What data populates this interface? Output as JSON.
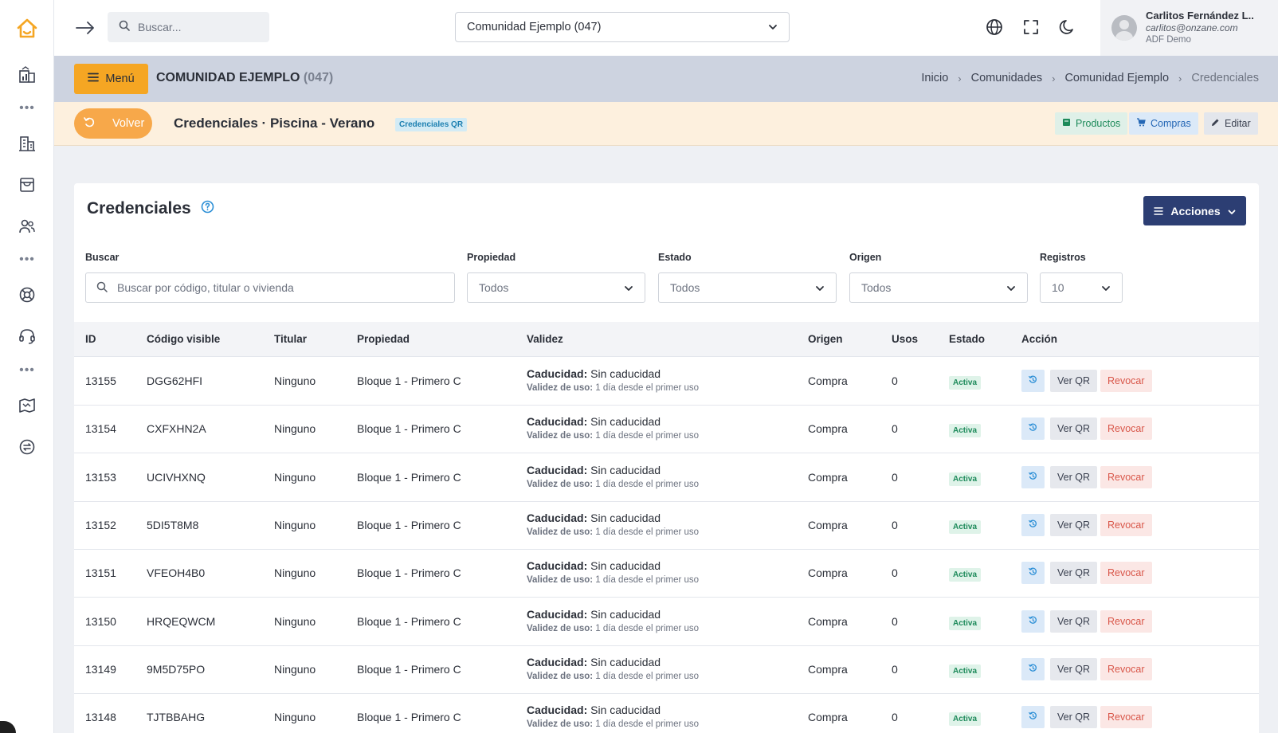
{
  "topbar": {
    "search_placeholder": "Buscar...",
    "community": "Comunidad Ejemplo (047)",
    "user": {
      "name": "Carlitos Fernández L..",
      "email": "carlitos@onzane.com",
      "org": "ADF Demo"
    }
  },
  "crumbbar": {
    "menu_label": "Menú",
    "community_name": "COMUNIDAD EJEMPLO",
    "community_code": "(047)",
    "breadcrumb": [
      "Inicio",
      "Comunidades",
      "Comunidad Ejemplo",
      "Credenciales"
    ]
  },
  "subheader": {
    "back_label": "Volver",
    "title": "Credenciales · Piscina - Verano",
    "tag": "Credenciales QR",
    "buttons": {
      "productos": "Productos",
      "compras": "Compras",
      "editar": "Editar"
    }
  },
  "card": {
    "title": "Credenciales",
    "actions_label": "Acciones",
    "filters": {
      "search_label": "Buscar",
      "search_placeholder": "Buscar por código, titular o vivienda",
      "propiedad_label": "Propiedad",
      "propiedad_value": "Todos",
      "estado_label": "Estado",
      "estado_value": "Todos",
      "origen_label": "Origen",
      "origen_value": "Todos",
      "registros_label": "Registros",
      "registros_value": "10"
    },
    "columns": [
      "ID",
      "Código visible",
      "Titular",
      "Propiedad",
      "Validez",
      "Origen",
      "Usos",
      "Estado",
      "Acción"
    ],
    "validity_labels": {
      "caducidad_label": "Caducidad:",
      "caducidad_value": "Sin caducidad",
      "uso_label": "Validez de uso:",
      "uso_value": "1 día desde el primer uso"
    },
    "action_labels": {
      "view_qr": "Ver QR",
      "revoke": "Revocar"
    },
    "rows": [
      {
        "id": "13155",
        "code": "DGG62HFI",
        "holder": "Ninguno",
        "property": "Bloque 1 - Primero C",
        "origin": "Compra",
        "uses": "0",
        "status": "Activa"
      },
      {
        "id": "13154",
        "code": "CXFXHN2A",
        "holder": "Ninguno",
        "property": "Bloque 1 - Primero C",
        "origin": "Compra",
        "uses": "0",
        "status": "Activa"
      },
      {
        "id": "13153",
        "code": "UCIVHXNQ",
        "holder": "Ninguno",
        "property": "Bloque 1 - Primero C",
        "origin": "Compra",
        "uses": "0",
        "status": "Activa"
      },
      {
        "id": "13152",
        "code": "5DI5T8M8",
        "holder": "Ninguno",
        "property": "Bloque 1 - Primero C",
        "origin": "Compra",
        "uses": "0",
        "status": "Activa"
      },
      {
        "id": "13151",
        "code": "VFEOH4B0",
        "holder": "Ninguno",
        "property": "Bloque 1 - Primero C",
        "origin": "Compra",
        "uses": "0",
        "status": "Activa"
      },
      {
        "id": "13150",
        "code": "HRQEQWCM",
        "holder": "Ninguno",
        "property": "Bloque 1 - Primero C",
        "origin": "Compra",
        "uses": "0",
        "status": "Activa"
      },
      {
        "id": "13149",
        "code": "9M5D75PO",
        "holder": "Ninguno",
        "property": "Bloque 1 - Primero C",
        "origin": "Compra",
        "uses": "0",
        "status": "Activa"
      },
      {
        "id": "13148",
        "code": "TJTBBAHG",
        "holder": "Ninguno",
        "property": "Bloque 1 - Primero C",
        "origin": "Compra",
        "uses": "0",
        "status": "Activa"
      }
    ]
  },
  "sidebar": {
    "icons": [
      "home-icon",
      "building-stats-icon",
      "buildings-icon",
      "store-icon",
      "users-icon",
      "support-ring-icon",
      "headset-icon",
      "map-icon",
      "exchange-icon"
    ]
  },
  "colors": {
    "accent_orange": "#f5a623",
    "navy": "#2c3e73",
    "crumb_bg": "#cdd3e0",
    "subheader_bg": "#fdf0de",
    "active_green": "#1d8a5a",
    "revoke_red": "#d9574a"
  }
}
